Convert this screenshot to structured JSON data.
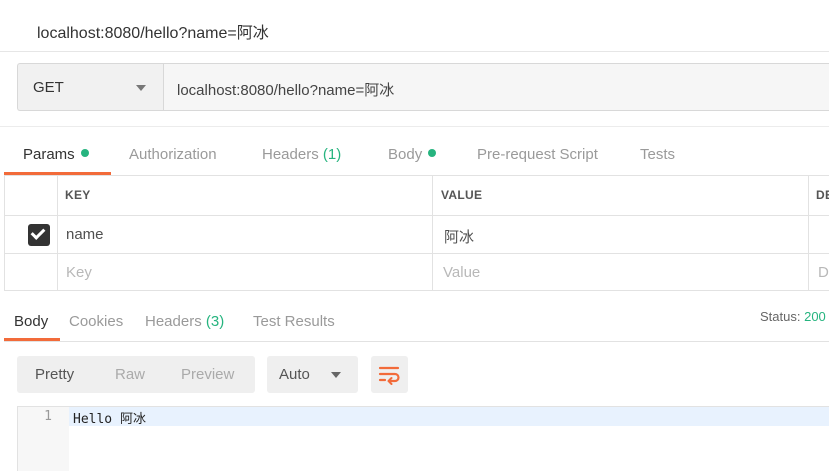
{
  "title": "localhost:8080/hello?name=阿冰",
  "request": {
    "method": "GET",
    "url": "localhost:8080/hello?name=阿冰"
  },
  "request_tabs": {
    "params": "Params",
    "authorization": "Authorization",
    "headers": "Headers",
    "headers_count": "(1)",
    "body": "Body",
    "prerequest": "Pre-request Script",
    "tests": "Tests"
  },
  "params_table": {
    "headers": {
      "key": "KEY",
      "value": "VALUE",
      "description_partial": "DE"
    },
    "rows": [
      {
        "checked": true,
        "key": "name",
        "value": "阿冰"
      }
    ],
    "placeholder": {
      "key": "Key",
      "value": "Value",
      "description_partial": "D"
    }
  },
  "response_tabs": {
    "body": "Body",
    "cookies": "Cookies",
    "headers": "Headers",
    "headers_count": "(3)",
    "test_results": "Test Results"
  },
  "status": {
    "label": "Status:",
    "value": "200"
  },
  "format_toolbar": {
    "pretty": "Pretty",
    "raw": "Raw",
    "preview": "Preview",
    "language": "Auto",
    "wrap_icon": "wrap-lines-icon"
  },
  "response_body": {
    "line_number": "1",
    "text": "Hello 阿冰"
  },
  "colors": {
    "accent": "#f26b3a",
    "status_green": "#26b47f"
  }
}
